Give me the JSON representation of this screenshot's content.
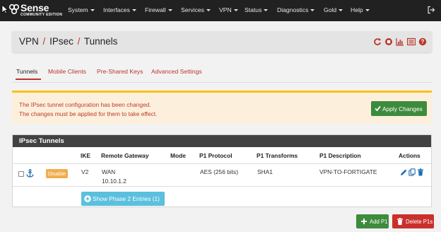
{
  "brand": {
    "name": "Sense",
    "subtitle": "COMMUNITY EDITION",
    "logo_icon": "pfsense-logo"
  },
  "nav": {
    "items": [
      {
        "label": "System"
      },
      {
        "label": "Interfaces"
      },
      {
        "label": "Firewall"
      },
      {
        "label": "Services"
      },
      {
        "label": "VPN"
      },
      {
        "label": "Status"
      },
      {
        "label": "Diagnostics"
      },
      {
        "label": "Gold"
      },
      {
        "label": "Help"
      }
    ],
    "logout_icon": "logout-icon"
  },
  "breadcrumb": {
    "parts": [
      "VPN",
      "IPsec",
      "Tunnels"
    ],
    "separator": "/",
    "icons": [
      "reload-icon",
      "stop-icon",
      "chart-icon",
      "list-icon",
      "help-icon"
    ]
  },
  "tabs": [
    {
      "label": "Tunnels",
      "active": true
    },
    {
      "label": "Mobile Clients",
      "active": false
    },
    {
      "label": "Pre-Shared Keys",
      "active": false
    },
    {
      "label": "Advanced Settings",
      "active": false
    }
  ],
  "alert": {
    "line1": "The IPsec tunnel configuration has been changed.",
    "line2": "The changes must be applied for them to take effect.",
    "apply_label": "Apply Changes"
  },
  "panel": {
    "title": "IPsec Tunnels",
    "columns": [
      "IKE",
      "Remote Gateway",
      "Mode",
      "P1 Protocol",
      "P1 Transforms",
      "P1 Description",
      "Actions"
    ],
    "rows": [
      {
        "status_label": "Disable",
        "ike": "V2",
        "remote_gateway_iface": "WAN",
        "remote_gateway_ip": "10.10.1.2",
        "mode": "",
        "p1_protocol": "AES (256 bits)",
        "p1_transforms": "SHA1",
        "p1_description": "VPN-TO-FORTIGATE"
      }
    ],
    "phase2_label": "Show Phase 2 Entries (1)"
  },
  "buttons": {
    "add_label": "Add P1",
    "delete_label": "Delete P1s"
  },
  "colors": {
    "navbar": "#212121",
    "accent_red": "#b9362b",
    "success": "#3d8b3d",
    "danger": "#c9302c",
    "info": "#5bc0de",
    "warning": "#f0ad4e",
    "alert_bg": "#fcf0dc",
    "alert_border": "#f5c318"
  }
}
